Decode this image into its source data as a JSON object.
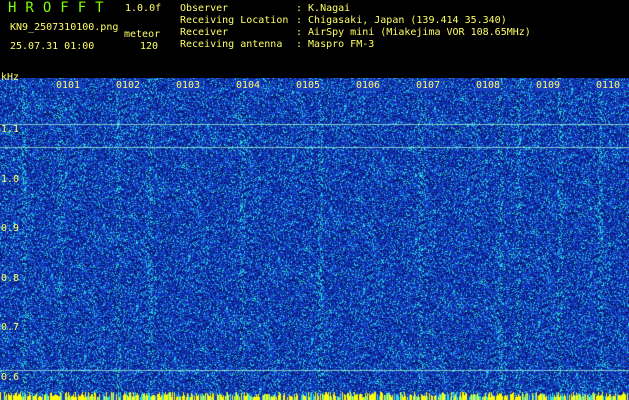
{
  "header": {
    "app_title": "HROFFT",
    "version": "1.0.0f",
    "filename": "KN9_2507310100.png",
    "meteor_label": "meteor",
    "datetime": "25.07.31 01:00",
    "meteor_count": "120"
  },
  "info": [
    {
      "label": "Observer",
      "value": ": K.Nagai"
    },
    {
      "label": "Receiving Location",
      "value": ": Chigasaki, Japan (139.414 35.340)"
    },
    {
      "label": "Receiver",
      "value": ": AirSpy mini (Miakejima VOR 108.65MHz)"
    },
    {
      "label": "Receiving antenna",
      "value": ": Maspro FM-3"
    }
  ],
  "spectrogram": {
    "unit": "kHz",
    "y_ticks": [
      "1.1",
      "1.0",
      "0.9",
      "0.8",
      "0.7",
      "0.6"
    ],
    "y_values": [
      1.1,
      1.0,
      0.9,
      0.8,
      0.7,
      0.6
    ],
    "x_ticks": [
      "0101",
      "0102",
      "0103",
      "0104",
      "0105",
      "0106",
      "0107",
      "0108",
      "0109",
      "0110"
    ],
    "colors": {
      "background": "#1a3fc0",
      "noise_cyan": "#20e0e0",
      "noise_dark": "#0a1e80",
      "line": "#9fffdf",
      "labels": "#ffff66",
      "title": "#7cff00"
    }
  }
}
